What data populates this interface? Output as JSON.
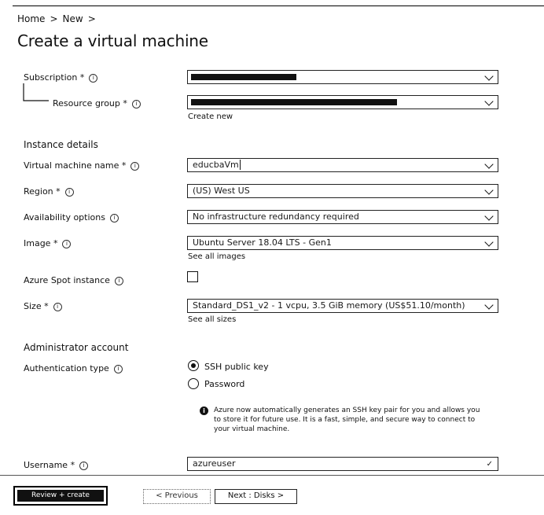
{
  "breadcrumb": {
    "home": "Home",
    "sep1": ">",
    "new": "New",
    "sep2": ">"
  },
  "page": {
    "title": "Create a virtual machine"
  },
  "project": {
    "subscription_label": "Subscription *",
    "resource_group_label": "Resource group *",
    "create_new_link": "Create new"
  },
  "instance": {
    "heading": "Instance details",
    "vm_name_label": "Virtual machine name *",
    "vm_name_value": "educbaVm",
    "region_label": "Region *",
    "region_value": "(US) West US",
    "availability_label": "Availability options",
    "availability_value": "No infrastructure redundancy required",
    "image_label": "Image *",
    "image_value": "Ubuntu Server 18.04 LTS - Gen1",
    "see_all_images": "See all images",
    "spot_label": "Azure Spot instance",
    "size_label": "Size *",
    "size_value": "Standard_DS1_v2 - 1 vcpu, 3.5 GiB memory (US$51.10/month)",
    "see_all_sizes": "See all sizes"
  },
  "admin": {
    "heading": "Administrator account",
    "auth_type_label": "Authentication type",
    "auth_options": [
      "SSH public key",
      "Password"
    ],
    "note": "Azure now automatically generates an SSH key pair for you and allows you to store it for future use. It is a fast, simple, and secure way to connect to your virtual machine.",
    "username_label": "Username *",
    "username_value": "azureuser"
  },
  "footer": {
    "review_create": "Review + create",
    "previous": "< Previous",
    "next": "Next : Disks >"
  }
}
